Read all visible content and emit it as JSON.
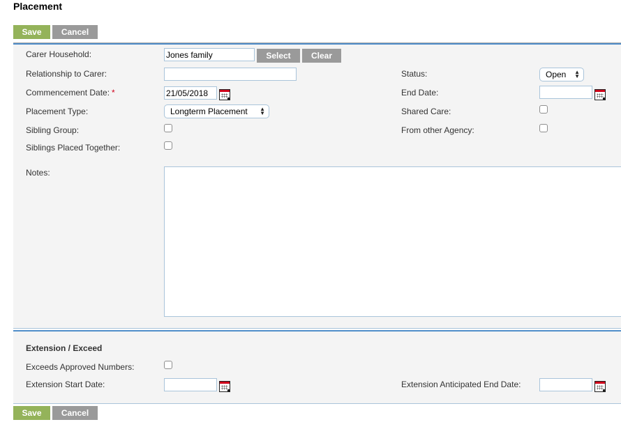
{
  "page": {
    "title": "Placement"
  },
  "toolbar": {
    "save_label": "Save",
    "cancel_label": "Cancel"
  },
  "form": {
    "carer_household": {
      "label": "Carer Household:",
      "value": "Jones family",
      "select_label": "Select",
      "clear_label": "Clear"
    },
    "relationship_to_carer": {
      "label": "Relationship to Carer:",
      "value": ""
    },
    "commencement_date": {
      "label": "Commencement Date:",
      "required_marker": "*",
      "value": "21/05/2018",
      "icon": "calendar-icon"
    },
    "placement_type": {
      "label": "Placement Type:",
      "selected": "Longterm Placement"
    },
    "sibling_group": {
      "label": "Sibling Group:",
      "checked": false
    },
    "siblings_placed_together": {
      "label": "Siblings Placed Together:",
      "checked": false
    },
    "status": {
      "label": "Status:",
      "selected": "Open"
    },
    "end_date": {
      "label": "End Date:",
      "value": "",
      "icon": "calendar-icon"
    },
    "shared_care": {
      "label": "Shared Care:",
      "checked": false
    },
    "from_other_agency": {
      "label": "From other Agency:",
      "checked": false
    },
    "notes": {
      "label": "Notes:",
      "value": ""
    }
  },
  "extension": {
    "heading": "Extension / Exceed",
    "exceeds_approved_numbers": {
      "label": "Exceeds Approved Numbers:",
      "checked": false
    },
    "extension_start_date": {
      "label": "Extension Start Date:",
      "value": "",
      "icon": "calendar-icon"
    },
    "extension_anticipated_end_date": {
      "label": "Extension Anticipated End Date:",
      "value": "",
      "icon": "calendar-icon"
    }
  },
  "colors": {
    "save": "#94b35a",
    "cancel": "#9a9a9a",
    "accent_border": "#4f8dc9",
    "required": "#d0021b"
  }
}
